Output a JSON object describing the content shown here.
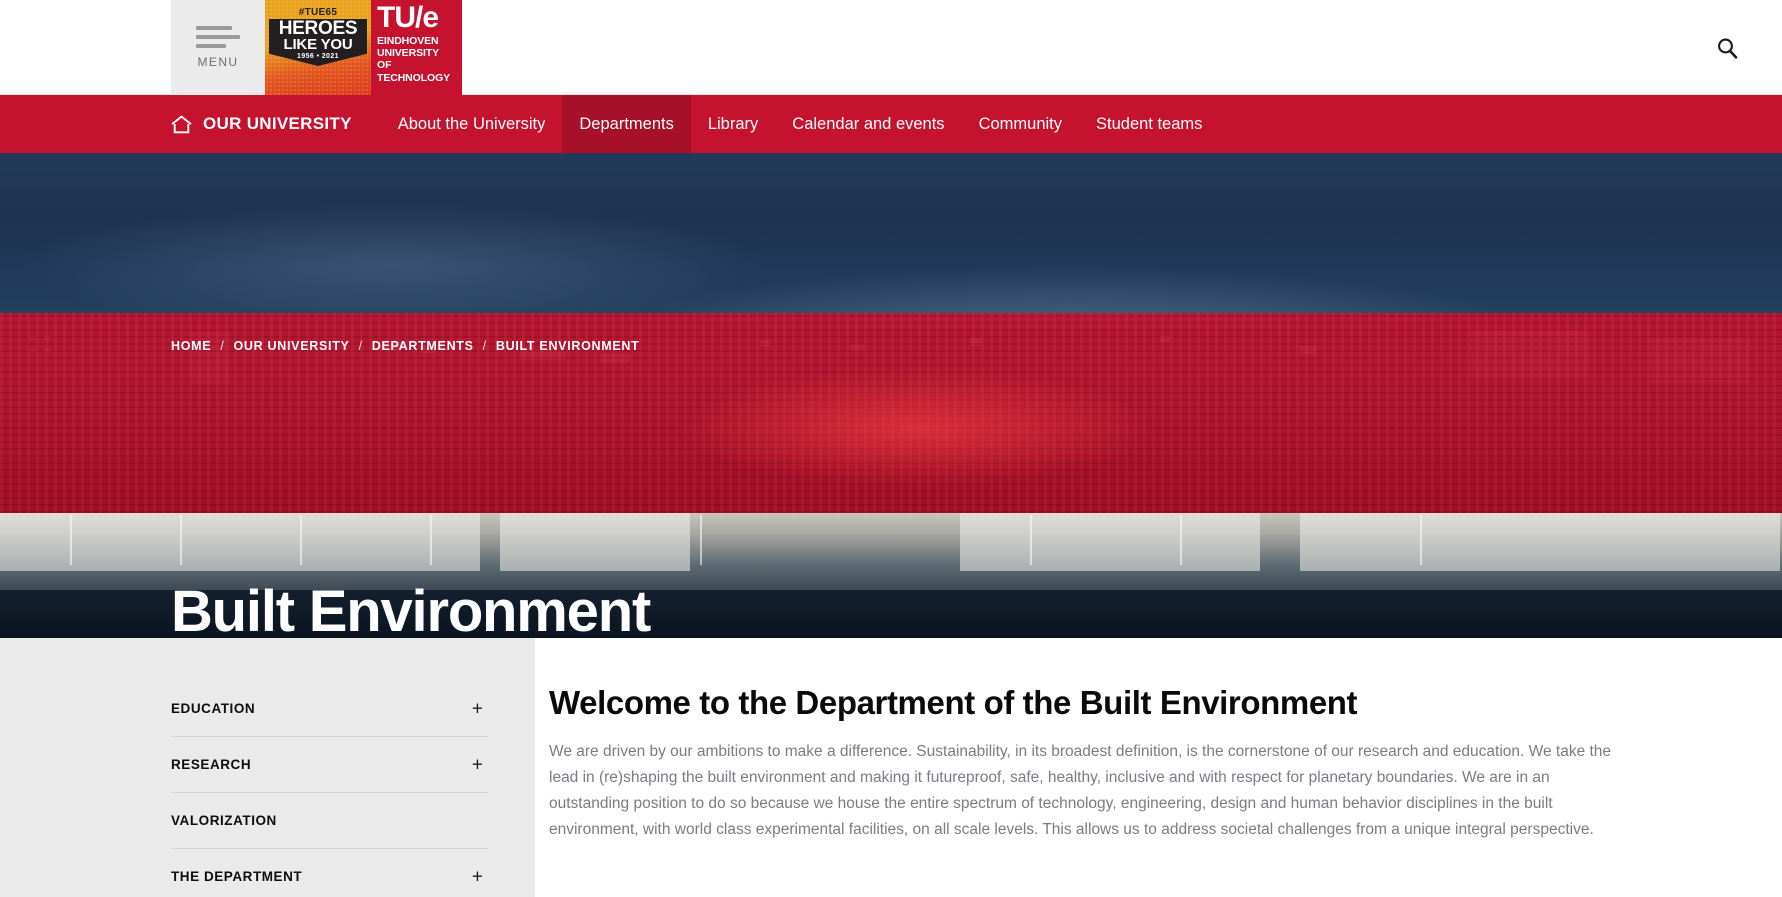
{
  "colors": {
    "brand_red": "#c4122f",
    "brand_red_active": "#a80f28",
    "sidebar_bg": "#eaeaea",
    "body_text": "#7b7b86",
    "heading": "#0a0a0a"
  },
  "header": {
    "menu_label": "MENU",
    "hamburger_icon": "hamburger-icon",
    "badge": {
      "tag": "#TUE65",
      "line1": "HEROES",
      "line2": "LIKE YOU",
      "years": "1956 • 2021"
    },
    "logo": {
      "wordmark": "TU/e",
      "subtitle_lines": [
        "EINDHOVEN",
        "UNIVERSITY",
        "OF",
        "TECHNOLOGY"
      ]
    },
    "search_icon": "search-icon"
  },
  "nav": {
    "home_icon": "home-icon",
    "brand_label": "OUR UNIVERSITY",
    "items": [
      {
        "label": "About the University",
        "active": false
      },
      {
        "label": "Departments",
        "active": true
      },
      {
        "label": "Library",
        "active": false
      },
      {
        "label": "Calendar and events",
        "active": false
      },
      {
        "label": "Community",
        "active": false
      },
      {
        "label": "Student teams",
        "active": false
      }
    ]
  },
  "hero": {
    "breadcrumb": [
      "HOME",
      "OUR UNIVERSITY",
      "DEPARTMENTS",
      "BUILT ENVIRONMENT"
    ],
    "breadcrumb_separator": "/",
    "title": "Built Environment"
  },
  "sidebar": {
    "items": [
      {
        "label": "EDUCATION",
        "expander": "+"
      },
      {
        "label": "RESEARCH",
        "expander": "+"
      },
      {
        "label": "VALORIZATION",
        "expander": ""
      },
      {
        "label": "THE DEPARTMENT",
        "expander": "+"
      }
    ]
  },
  "main": {
    "heading": "Welcome to the Department of the Built Environment",
    "paragraph": "We are driven by our ambitions to make a difference. Sustainability, in its broadest definition, is the cornerstone of our research and education. We take the lead in (re)shaping the built environment and making it futureproof, safe, healthy, inclusive and with respect for planetary boundaries. We are in an outstanding position to do so because we house the entire spectrum of technology, engineering, design and human behavior disciplines in the built environment, with world class experimental facilities, on all scale levels. This allows us to address societal challenges from a unique integral perspective."
  }
}
